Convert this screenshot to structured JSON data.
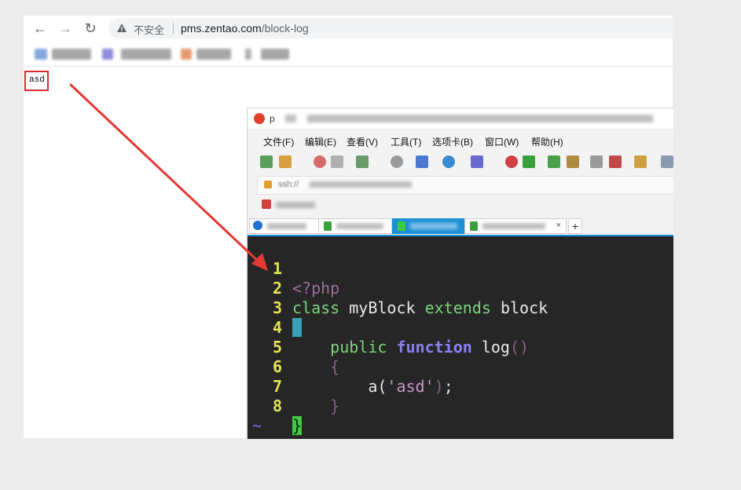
{
  "browser": {
    "nav": {
      "back": "←",
      "forward": "→",
      "reload": "↻"
    },
    "security_label": "不安全",
    "url_host": "pms.zentao.com",
    "url_path": "/block-log",
    "page_output": "asd"
  },
  "inner_window": {
    "title_prefix": "p",
    "menu": [
      "文件(F)",
      "编辑(E)",
      "查看(V)",
      "工具(T)",
      "选项卡(B)",
      "窗口(W)",
      "帮助(H)"
    ],
    "address_text": "ssh://",
    "tab_add": "+",
    "tab_close": "×"
  },
  "editor": {
    "lines": [
      {
        "num": "1",
        "text": "<?php"
      },
      {
        "num": "2",
        "text": "class myBlock extends block"
      },
      {
        "num": "3",
        "text": "{"
      },
      {
        "num": "4",
        "text": "    public function log()"
      },
      {
        "num": "5",
        "text": "    {"
      },
      {
        "num": "6",
        "text": "        a('asd');"
      },
      {
        "num": "7",
        "text": "    }"
      },
      {
        "num": "8",
        "text": "}"
      }
    ],
    "tokens": {
      "php_open": "<?php",
      "kw_class": "class",
      "class_name": "myBlock",
      "kw_extends": "extends",
      "parent": "block",
      "brace_open": "{",
      "kw_public": "public",
      "kw_function": "function",
      "fn_name": "log",
      "parens": "()",
      "call_name": "a",
      "paren_open": "(",
      "string": "'asd'",
      "paren_close": ")",
      "semicolon": ";",
      "brace_close": "}"
    },
    "tilde": "~"
  },
  "colors": {
    "annotation_red": "#d32f2f",
    "terminal_bg": "#262626",
    "line_number": "#e4e44f",
    "keyword_green": "#7bd37b",
    "keyword_purple": "#8b7ff0",
    "tab_active": "#1e90d6"
  }
}
